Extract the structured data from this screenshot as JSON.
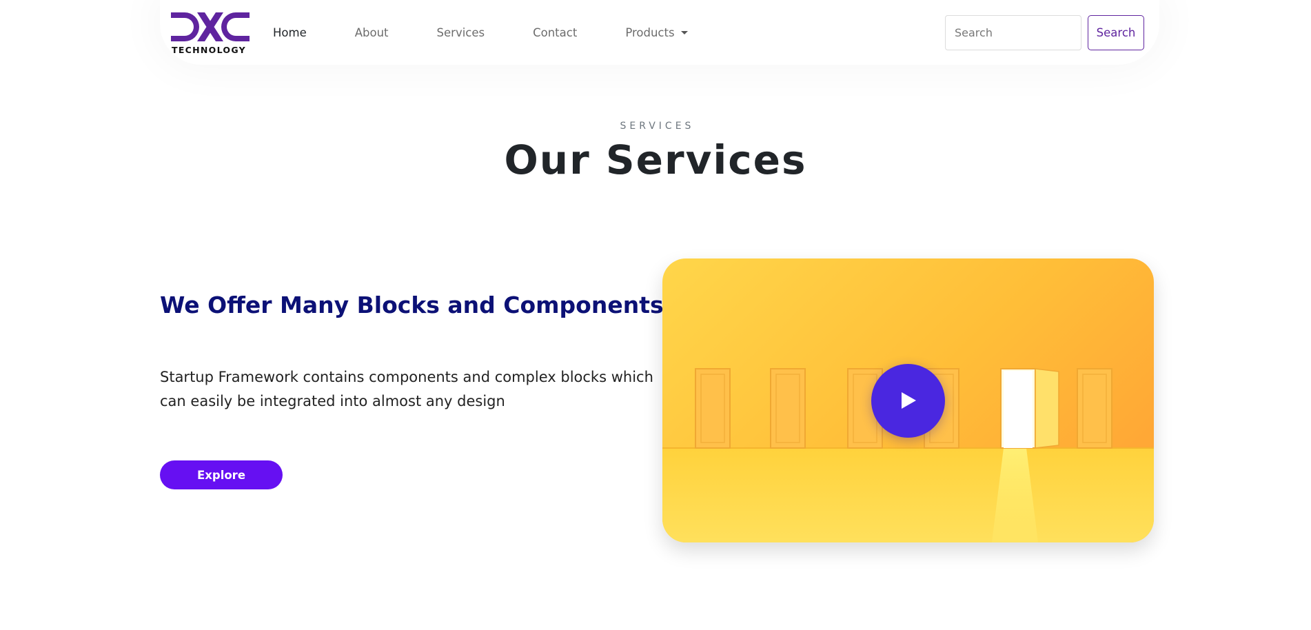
{
  "brand": {
    "name": "DXC",
    "tagline": "TECHNOLOGY",
    "color": "#5f249f"
  },
  "nav": {
    "items": [
      {
        "label": "Home",
        "active": true
      },
      {
        "label": "About"
      },
      {
        "label": "Services"
      },
      {
        "label": "Contact"
      },
      {
        "label": "Products",
        "dropdown": true
      }
    ]
  },
  "search": {
    "placeholder": "Search",
    "button_label": "Search"
  },
  "section": {
    "eyebrow": "SERVICES",
    "title": "Our Services"
  },
  "content": {
    "heading": "We Offer Many Blocks and Components",
    "description": "Startup Framework contains components and complex blocks which can easily be integrated into almost any design",
    "cta_label": "Explore"
  },
  "media": {
    "play_icon": "play-icon",
    "accent": "#4a27e0"
  },
  "colors": {
    "heading_blue": "#0c1176",
    "button_purple": "#6610f2"
  }
}
